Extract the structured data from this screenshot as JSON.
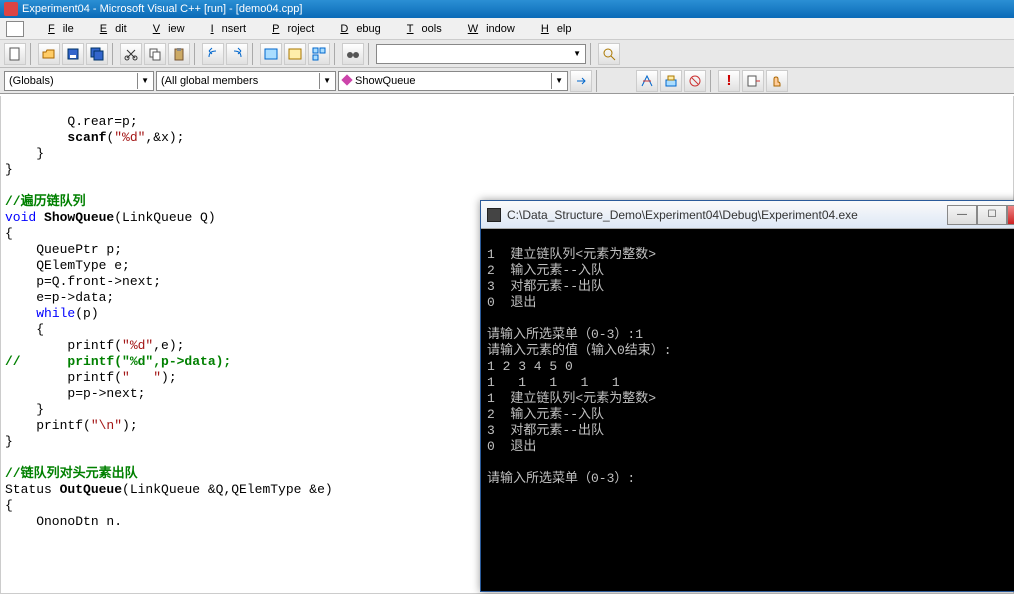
{
  "title": "Experiment04 - Microsoft Visual C++ [run] - [demo04.cpp]",
  "menu": [
    "File",
    "Edit",
    "View",
    "Insert",
    "Project",
    "Debug",
    "Tools",
    "Window",
    "Help"
  ],
  "toolbar1": {
    "dropdown_value": ""
  },
  "toolbar2": {
    "scope": "(Globals)",
    "members": "(All global members",
    "func": "ShowQueue"
  },
  "code": {
    "l1": "        Q.rear=p;",
    "l2": "        scanf(\"%d\",&x);",
    "l3": "    }",
    "l4": "}",
    "l5": "",
    "l6": "//遍历链队列",
    "l7a": "void",
    "l7b": " ShowQueue",
    "l7c": "(LinkQueue Q)",
    "l8": "{",
    "l9": "    QueuePtr p;",
    "l10": "    QElemType e;",
    "l11": "    p=Q.front->next;",
    "l12": "    e=p->data;",
    "l13a": "    ",
    "l13b": "while",
    "l13c": "(p)",
    "l14": "    {",
    "l15a": "        printf(",
    "l15b": "\"%d\"",
    "l15c": ",e);",
    "l16": "//      printf(\"%d\",p->data);",
    "l17a": "        printf(",
    "l17b": "\"   \"",
    "l17c": ");",
    "l18": "        p=p->next;",
    "l19": "    }",
    "l20a": "    printf(",
    "l20b": "\"\\n\"",
    "l20c": ");",
    "l21": "}",
    "l22": "",
    "l23": "//链队列对头元素出队",
    "l24a": "Status ",
    "l24b": "OutQueue",
    "l24c": "(LinkQueue &Q,QElemType &e)",
    "l25": "{",
    "l26": "    OnonoDtn n."
  },
  "console": {
    "title": "C:\\Data_Structure_Demo\\Experiment04\\Debug\\Experiment04.exe",
    "lines": [
      "1  建立链队列<元素为整数>",
      "2  输入元素--入队",
      "3  对都元素--出队",
      "0  退出",
      "",
      "请输入所选菜单（0-3）:1",
      "请输入元素的值（输入0结束）:",
      "1 2 3 4 5 0",
      "1   1   1   1   1",
      "1  建立链队列<元素为整数>",
      "2  输入元素--入队",
      "3  对都元素--出队",
      "0  退出",
      "",
      "请输入所选菜单（0-3）:"
    ]
  }
}
